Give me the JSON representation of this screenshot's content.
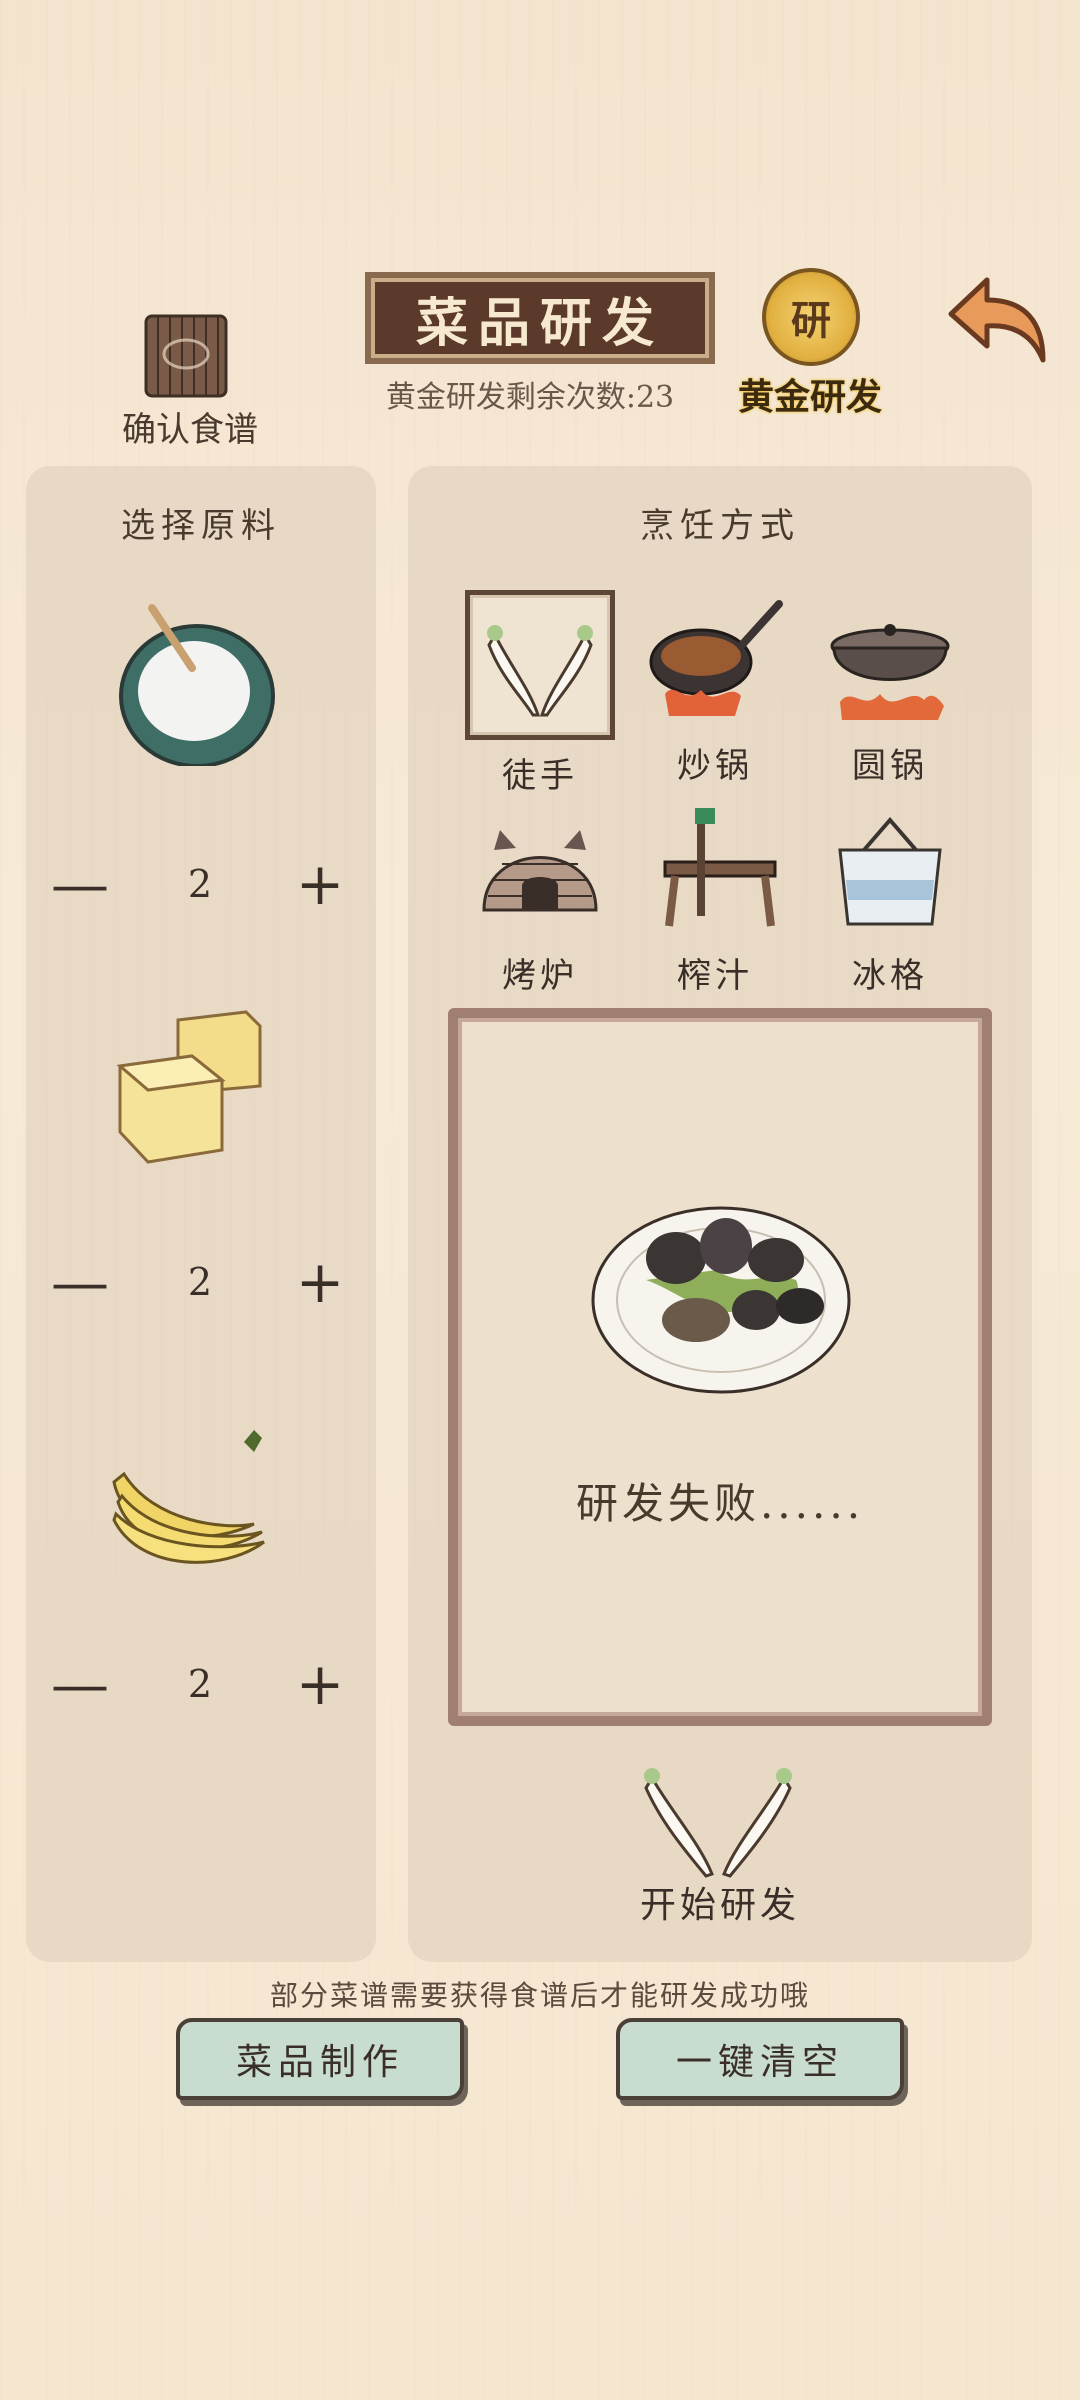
{
  "header": {
    "title": "菜品研发",
    "gold_remaining": "黄金研发剩余次数:23",
    "confirm_recipe_label": "确认食谱",
    "gold_dev_label": "黄金研发",
    "gold_medal_glyph": "研",
    "icons": {
      "scroll": "scroll-icon",
      "medal": "gold-medal-icon",
      "back": "back-arrow-icon"
    }
  },
  "ingredients": {
    "title": "选择原料",
    "items": [
      {
        "icon": "salt-bowl-icon",
        "minus": "—",
        "qty": "2",
        "plus": "+"
      },
      {
        "icon": "tofu-cubes-icon",
        "minus": "—",
        "qty": "2",
        "plus": "+"
      },
      {
        "icon": "banana-icon",
        "minus": "—",
        "qty": "2",
        "plus": "+"
      }
    ]
  },
  "cooking": {
    "title": "烹饪方式",
    "methods": [
      {
        "label": "徒手",
        "icon": "bare-hands-icon",
        "selected": true
      },
      {
        "label": "炒锅",
        "icon": "wok-icon",
        "selected": false
      },
      {
        "label": "圆锅",
        "icon": "round-pot-icon",
        "selected": false
      },
      {
        "label": "烤炉",
        "icon": "oven-icon",
        "selected": false
      },
      {
        "label": "榨汁",
        "icon": "juicer-icon",
        "selected": false
      },
      {
        "label": "冰格",
        "icon": "ice-box-icon",
        "selected": false
      }
    ]
  },
  "result": {
    "text": "研发失败......",
    "icon": "failed-dish-icon"
  },
  "start": {
    "label": "开始研发",
    "icon": "start-hands-icon"
  },
  "footer": {
    "tip": "部分菜谱需要获得食谱后才能研发成功哦",
    "make_dish_label": "菜品制作",
    "clear_all_label": "一键清空"
  },
  "colors": {
    "panel": "#d7c8b4",
    "title_plate": "#5b3a2c",
    "button": "#c9dcd0",
    "gold": "#e1b040"
  }
}
